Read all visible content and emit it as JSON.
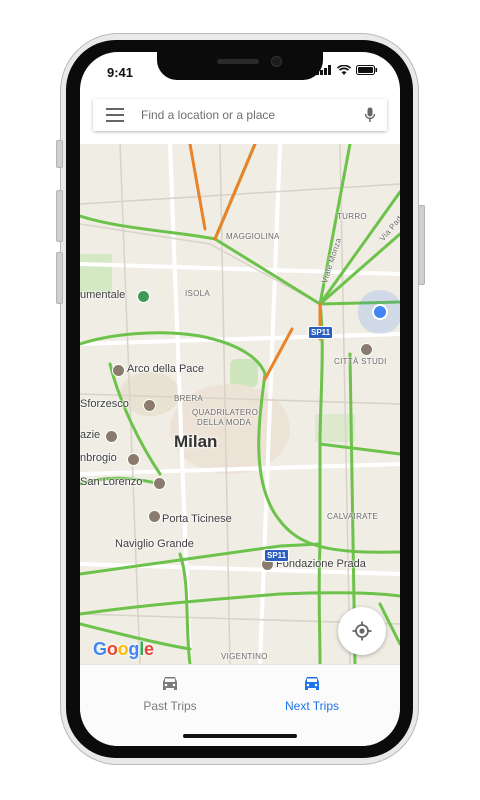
{
  "status_bar": {
    "time": "9:41"
  },
  "search": {
    "placeholder": "Find a location or a place"
  },
  "map": {
    "city": "Milan",
    "places": [
      "umentale",
      "Arco della Pace",
      "Sforzesco",
      "azie",
      "nbrogio",
      "San Lorenzo",
      "Porta Ticinese",
      "Naviglio Grande",
      "Fondazione Prada",
      "CITTÀ STUDI"
    ],
    "districts": [
      "MAGGIOLINA",
      "ISOLA",
      "BRERA",
      "QUADRILATERO",
      "DELLA MODA",
      "TURRO",
      "CALVAIRATE",
      "VIGENTINO",
      "Viale Monza",
      "Via Pad"
    ],
    "shields": [
      "SP11",
      "SP11"
    ],
    "attribution": "Google"
  },
  "tabs": [
    {
      "label": "Past Trips",
      "icon": "car-icon",
      "color": "#7a7a7a"
    },
    {
      "label": "Next Trips",
      "icon": "car-icon",
      "color": "#1a73e8"
    }
  ],
  "colors": {
    "traffic_green": "#6cc24a",
    "traffic_orange": "#e8832a",
    "accent": "#1a73e8"
  }
}
